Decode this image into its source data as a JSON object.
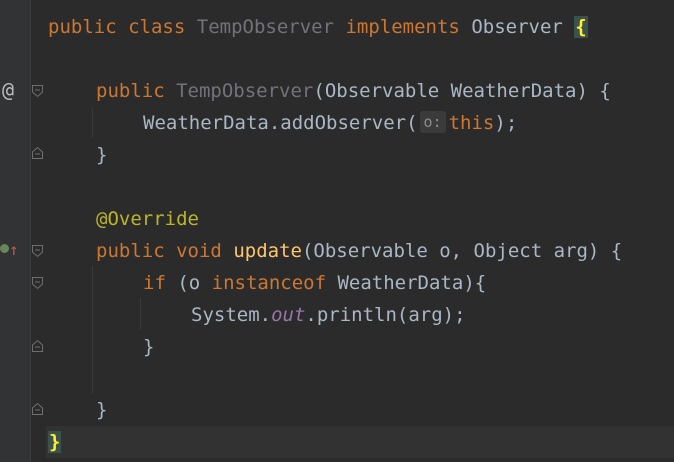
{
  "editor": {
    "gutter_icons": {
      "override_marker": "@",
      "implements_marker": "↑"
    },
    "lines": [
      {
        "tokens": [
          "public",
          "class",
          "TempObserver",
          "implements",
          "Observer",
          "{"
        ]
      },
      {
        "tokens": []
      },
      {
        "tokens": [
          "public",
          "TempObserver",
          "(Observable WeatherData) {"
        ]
      },
      {
        "tokens": [
          "WeatherData.addObserver(",
          "o:",
          "this",
          ");"
        ]
      },
      {
        "tokens": [
          "}"
        ]
      },
      {
        "tokens": []
      },
      {
        "tokens": [
          "@Override"
        ]
      },
      {
        "tokens": [
          "public",
          "void",
          "update",
          "(Observable o, Object arg) {"
        ]
      },
      {
        "tokens": [
          "if",
          " (o ",
          "instanceof",
          " WeatherData){"
        ]
      },
      {
        "tokens": [
          "System.",
          "out",
          ".println(arg);"
        ]
      },
      {
        "tokens": [
          "}"
        ]
      },
      {
        "tokens": []
      },
      {
        "tokens": [
          "}"
        ]
      },
      {
        "tokens": [
          "}"
        ]
      }
    ]
  },
  "colors": {
    "background": "#2b2b2b",
    "keyword": "#cc7832",
    "text": "#a9b7c6",
    "method": "#ffc66d",
    "annotation": "#bbb529",
    "field": "#9876aa",
    "brace_highlight": "#ffef28"
  }
}
